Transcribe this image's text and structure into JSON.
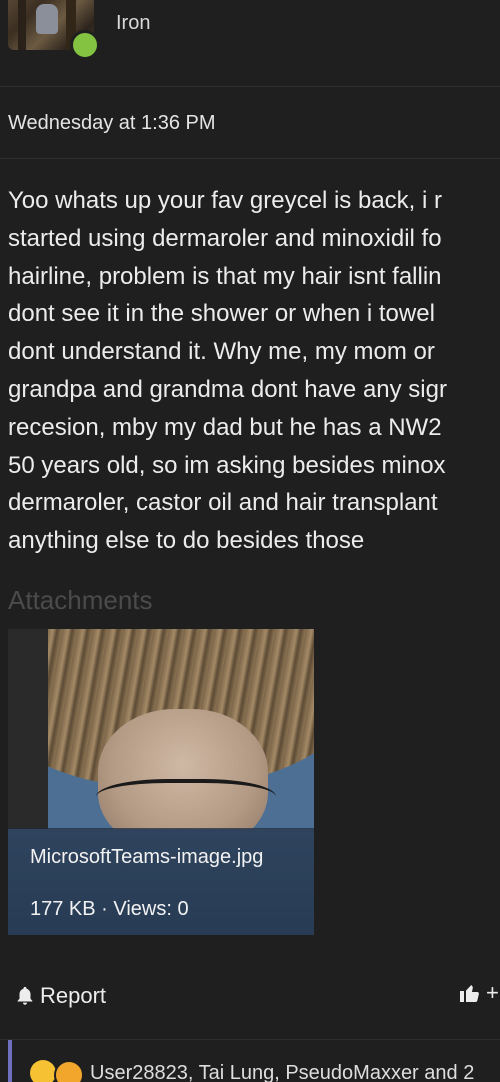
{
  "user": {
    "name": "Iron",
    "status_color": "#84c341",
    "avatar_icon": "user-avatar-photo"
  },
  "post": {
    "timestamp": "Wednesday at 1:36 PM",
    "body_lines": [
      "Yoo whats up your fav greycel is back, i r",
      "started using dermaroler and minoxidil fo",
      "hairline, problem is that my hair isnt fallin",
      "dont see it in the shower or when i towel",
      "dont understand it. Why me, my mom or",
      "grandpa and grandma dont have any sigr",
      "recesion, mby my dad but he has a NW2",
      "50 years old, so im asking besides minox",
      "dermaroler, castor oil and hair transplant",
      "anything else to do besides those"
    ]
  },
  "attachments": {
    "title": "Attachments",
    "items": [
      {
        "filename": "MicrosoftTeams-image.jpg",
        "meta": "177 KB · Views: 0"
      }
    ]
  },
  "actions": {
    "report_label": "Report",
    "like_label": "+",
    "report_icon": "bell-icon",
    "like_icon": "thumbs-up-icon"
  },
  "reactions": {
    "text": "User28823, Tai Lung, PseudoMaxxer and 2",
    "accent_color": "#6f6fbf"
  }
}
